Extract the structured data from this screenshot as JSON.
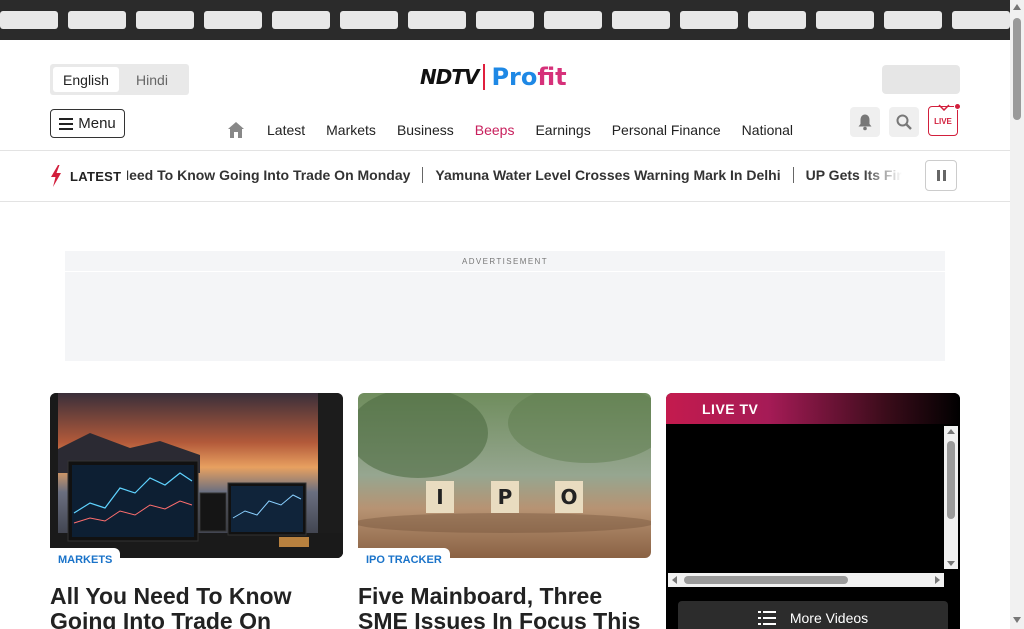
{
  "colors": {
    "accent_pink": "#c8205d",
    "brand_red": "#d21f3c",
    "link_blue": "#1a73c9",
    "logo_blue": "#1e88e5",
    "topbar_bg": "#2b2b2b"
  },
  "language": {
    "options": [
      "English",
      "Hindi"
    ],
    "selected": "English"
  },
  "logo": {
    "primary": "NDTV",
    "secondary_a": "Pro",
    "secondary_b": "fit"
  },
  "header": {
    "menu_label": "Menu",
    "nav_items": [
      "Latest",
      "Markets",
      "Business",
      "Beeps",
      "Earnings",
      "Personal Finance",
      "National"
    ],
    "icons": [
      "home-icon",
      "bell-icon",
      "search-icon",
      "live-tv-icon"
    ],
    "live_label": "LIVE"
  },
  "ticker": {
    "label": "LATEST",
    "items": [
      "Need To Know Going Into Trade On Monday",
      "Yamuna Water Level Crosses Warning Mark In Delhi",
      "UP Gets Its First Gree"
    ]
  },
  "ad": {
    "label": "ADVERTISEMENT"
  },
  "cards": [
    {
      "tag": "MARKETS",
      "title": "All You Need To Know Going Into Trade On"
    },
    {
      "tag": "IPO TRACKER",
      "title": "Five Mainboard, Three SME Issues In Focus This",
      "tiles": [
        "I",
        "P",
        "O"
      ]
    }
  ],
  "live_tv": {
    "title": "LIVE TV",
    "more_label": "More Videos"
  }
}
